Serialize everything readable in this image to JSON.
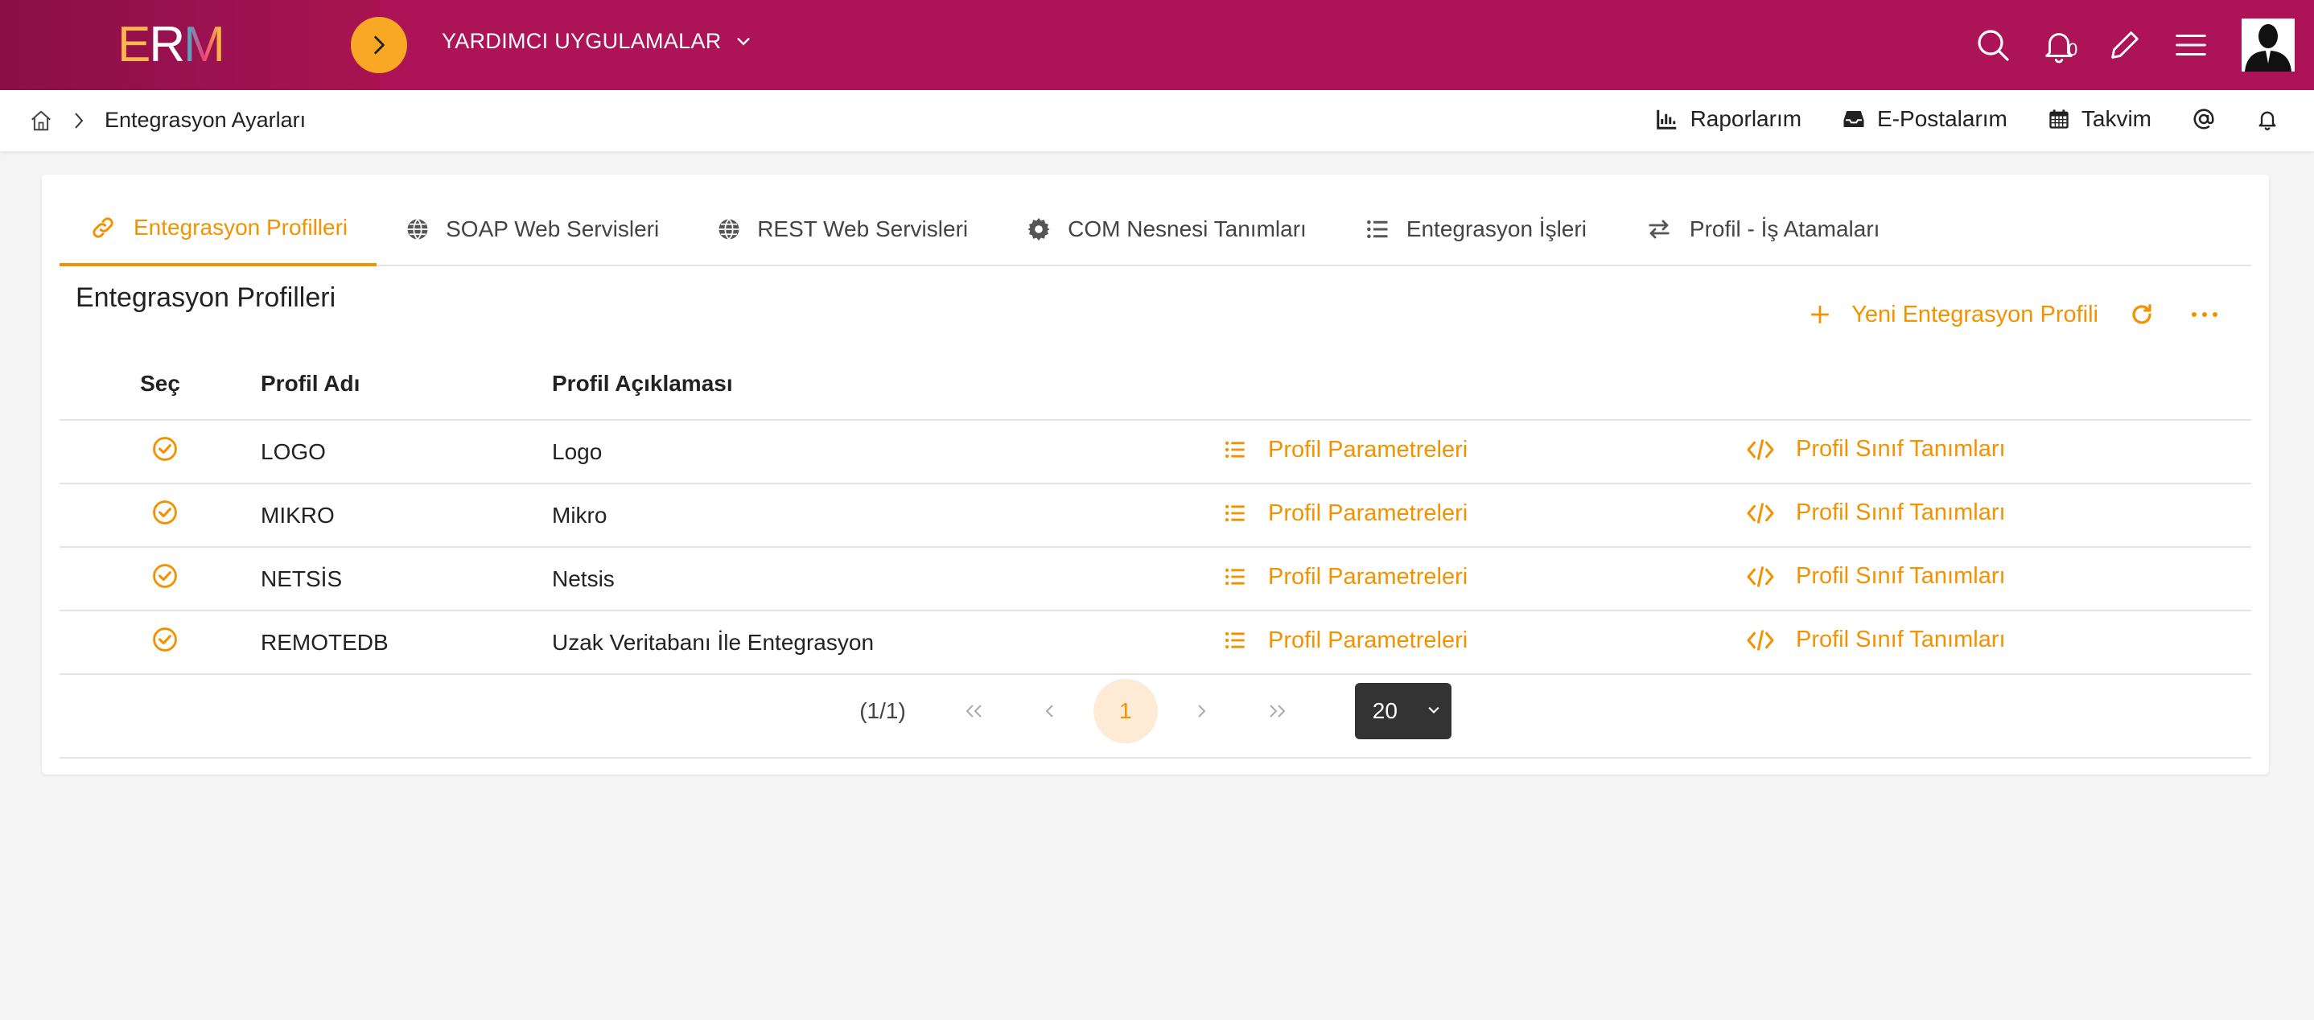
{
  "header": {
    "logo_text": "ERM",
    "apps_menu_label": "YARDIMCI UYGULAMALAR",
    "notification_count": "0",
    "colors": {
      "topbar": "#ad1457",
      "accent": "#f39200",
      "toggle": "#f9a825"
    }
  },
  "breadcrumb": {
    "current": "Entegrasyon Ayarları"
  },
  "quick_links": [
    {
      "label": "Raporlarım",
      "icon": "report-chart-icon"
    },
    {
      "label": "E-Postalarım",
      "icon": "inbox-icon"
    },
    {
      "label": "Takvim",
      "icon": "calendar-icon"
    }
  ],
  "tabs": [
    {
      "label": "Entegrasyon Profilleri",
      "icon": "link-icon",
      "active": true
    },
    {
      "label": "SOAP Web Servisleri",
      "icon": "globe-icon",
      "active": false
    },
    {
      "label": "REST Web Servisleri",
      "icon": "globe-icon",
      "active": false
    },
    {
      "label": "COM Nesnesi Tanımları",
      "icon": "gear-icon",
      "active": false
    },
    {
      "label": "Entegrasyon İşleri",
      "icon": "list-icon",
      "active": false
    },
    {
      "label": "Profil - İş Atamaları",
      "icon": "exchange-icon",
      "active": false
    }
  ],
  "main": {
    "title": "Entegrasyon Profilleri",
    "new_button_label": "Yeni Entegrasyon Profili",
    "columns": {
      "select": "Seç",
      "name": "Profil Adı",
      "description": "Profil Açıklaması"
    },
    "row_actions": {
      "params": "Profil Parametreleri",
      "classes": "Profil Sınıf Tanımları"
    },
    "rows": [
      {
        "name": "LOGO",
        "description": "Logo"
      },
      {
        "name": "MIKRO",
        "description": "Mikro"
      },
      {
        "name": "NETSİS",
        "description": "Netsis"
      },
      {
        "name": "REMOTEDB",
        "description": "Uzak Veritabanı İle Entegrasyon"
      }
    ]
  },
  "pager": {
    "info": "(1/1)",
    "current_page": "1",
    "page_size": "20"
  }
}
